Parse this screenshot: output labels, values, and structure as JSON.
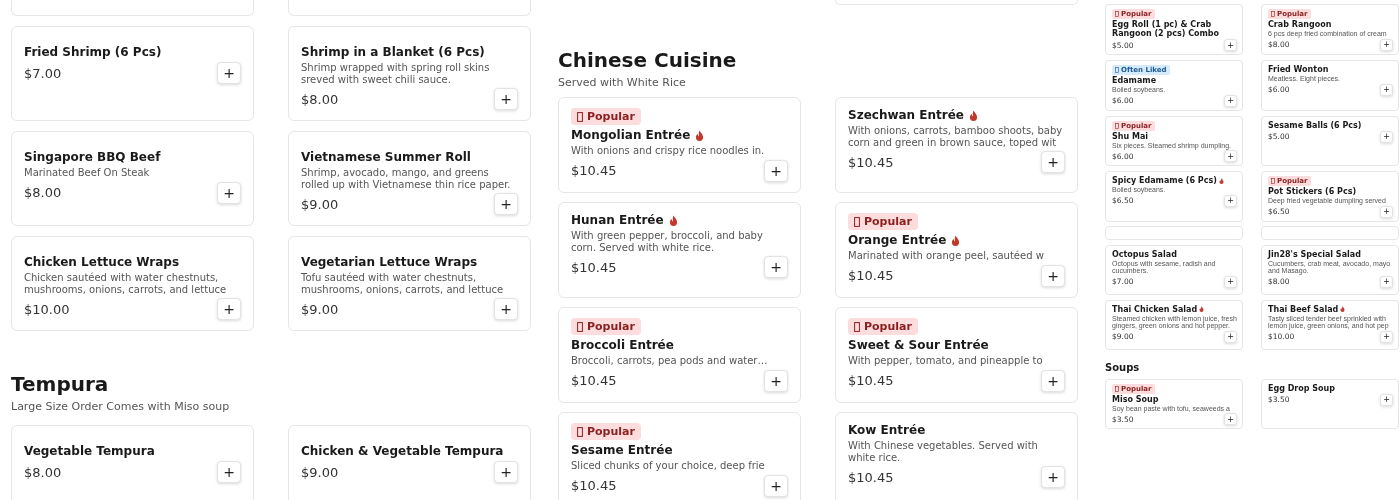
{
  "panels": [
    {
      "sections": [
        {
          "clipped_row_above": [
            {
              "shown": true
            },
            {
              "shown": true
            }
          ],
          "items": [
            {
              "name": "Fried Shrimp (6 Pcs)",
              "spicy": false,
              "price": "$7.00",
              "add_button": "+"
            },
            {
              "name": "Shrimp in a Blanket (6 Pcs)",
              "spicy": false,
              "description": "Shrimp wrapped with spring roll skins sreved with sweet chili sauce.",
              "price": "$8.00",
              "add_button": "+"
            },
            {
              "name": "Singapore BBQ Beef",
              "spicy": false,
              "description": "Marinated Beef On Steak",
              "price": "$8.00",
              "add_button": "+"
            },
            {
              "name": "Vietnamese Summer Roll",
              "spicy": false,
              "description": "Shrimp, avocado, mango, and greens rolled up with Vietnamese thin rice paper.",
              "price": "$9.00",
              "add_button": "+"
            },
            {
              "name": "Chicken Lettuce Wraps",
              "spicy": false,
              "description": "Chicken sautéed with water chestnuts, mushrooms, onions, carrots, and lettuce",
              "price": "$10.00",
              "add_button": "+"
            },
            {
              "name": "Vegetarian Lettuce Wraps",
              "spicy": false,
              "description": "Tofu sautéed with water chestnuts, mushrooms, onions, carrots, and lettuce",
              "price": "$9.00",
              "add_button": "+"
            }
          ]
        },
        {
          "title": "Tempura",
          "subtitle": "Large Size Order Comes with Miso soup",
          "items": [
            {
              "name": "Vegetable Tempura",
              "spicy": false,
              "price": "$8.00",
              "add_button": "+"
            },
            {
              "name": "Chicken & Vegetable Tempura",
              "spicy": false,
              "price": "$9.00",
              "add_button": "+"
            }
          ]
        }
      ]
    },
    {
      "sections": [
        {
          "clipped_row_above": [
            {
              "shown": false
            },
            {
              "shown": true
            }
          ],
          "title": "Chinese Cuisine",
          "subtitle": "Served with White Rice",
          "items": [
            {
              "badge": {
                "kind": "popular",
                "text": "Popular"
              },
              "name": "Mongolian Entrée",
              "spicy": true,
              "description": "With onions and crispy rice noodles in.",
              "price": "$10.45",
              "add_button": "+"
            },
            {
              "name": "Szechwan Entrée",
              "spicy": true,
              "description": "With onions, carrots, bamboo shoots, baby corn and green in brown sauce, toped wit",
              "price": "$10.45",
              "add_button": "+"
            },
            {
              "name": "Hunan Entrée",
              "spicy": true,
              "description": "With green pepper, broccoli, and baby corn. Served with white rice.",
              "price": "$10.45",
              "add_button": "+"
            },
            {
              "badge": {
                "kind": "popular",
                "text": "Popular"
              },
              "name": "Orange Entrée",
              "spicy": true,
              "description": "Marinated with orange peel, sautéed w",
              "price": "$10.45",
              "add_button": "+"
            },
            {
              "badge": {
                "kind": "popular",
                "text": "Popular"
              },
              "name": "Broccoli Entrée",
              "spicy": false,
              "description": "Broccoli, carrots, pea pods and water…",
              "price": "$10.45",
              "add_button": "+"
            },
            {
              "badge": {
                "kind": "popular",
                "text": "Popular"
              },
              "name": "Sweet & Sour Entrée",
              "spicy": false,
              "description": "With pepper, tomato, and pineapple to",
              "price": "$10.45",
              "add_button": "+"
            },
            {
              "badge": {
                "kind": "popular",
                "text": "Popular"
              },
              "name": "Sesame Entrée",
              "spicy": false,
              "description": "Sliced chunks of your choice, deep frie",
              "price": "$10.45",
              "add_button": "+"
            },
            {
              "name": "Kow Entrée",
              "spicy": false,
              "description": "With Chinese vegetables. Served with white rice.",
              "price": "$10.45",
              "add_button": "+"
            }
          ]
        }
      ]
    },
    {
      "sections": [
        {
          "items": [
            {
              "badge": {
                "kind": "popular",
                "text": "Popular"
              },
              "name": "Egg Roll (1 pc) & Crab Rangoon (2 pcs) Combo",
              "spicy": false,
              "price": "$5.00",
              "add_button": "+"
            },
            {
              "badge": {
                "kind": "popular",
                "text": "Popular"
              },
              "name": "Crab Rangoon",
              "spicy": false,
              "description": "6 pcs deep fried combination of cream",
              "price": "$8.00",
              "add_button": "+"
            },
            {
              "badge": {
                "kind": "often_liked",
                "text": "Often Liked"
              },
              "name": "Edamame",
              "spicy": false,
              "description": "Boiled soybeans.",
              "price": "$6.00",
              "add_button": "+"
            },
            {
              "name": "Fried Wonton",
              "spicy": false,
              "description": "Meatless. Eight pieces.",
              "price": "$6.00",
              "add_button": "+"
            },
            {
              "badge": {
                "kind": "popular",
                "text": "Popular"
              },
              "name": "Shu Mai",
              "spicy": false,
              "description": "Six pieces. Steamed shrimp dumpling.",
              "price": "$6.00",
              "add_button": "+"
            },
            {
              "name": "Sesame Balls (6 Pcs)",
              "spicy": false,
              "price": "$5.00",
              "add_button": "+"
            },
            {
              "name": "Spicy Edamame (6 Pcs)",
              "spicy": true,
              "description": "Boiled soybeans.",
              "price": "$6.50",
              "add_button": "+"
            },
            {
              "badge": {
                "kind": "popular",
                "text": "Popular"
              },
              "name": "Pot Stickers (6 Pcs)",
              "spicy": false,
              "description": "Deep fried vegetable dumpling served",
              "price": "$6.50",
              "add_button": "+"
            }
          ]
        },
        {
          "clipped_row_above": [
            {
              "shown": true
            },
            {
              "shown": true
            }
          ],
          "items": [
            {
              "name": "Octopus Salad",
              "spicy": false,
              "description": "Octopus with sesame, radish and cucumbers.",
              "price": "$7.00",
              "add_button": "+"
            },
            {
              "name": "Jin28's Special Salad",
              "spicy": false,
              "description": "Cucumbers, crab meat, avocado, mayo and Masago.",
              "price": "$8.00",
              "add_button": "+"
            },
            {
              "name": "Thai Chicken Salad",
              "spicy": true,
              "description": "Steamed chicken with lemon juice, fresh gingers, green onions and hot pepper.",
              "price": "$9.00",
              "add_button": "+"
            },
            {
              "name": "Thai Beef Salad",
              "spicy": true,
              "description": "Tasty sliced tender beef sprinkled with lemon juice, green onions, and hot pep",
              "price": "$10.00",
              "add_button": "+"
            }
          ]
        },
        {
          "title": "Soups",
          "items": [
            {
              "badge": {
                "kind": "popular",
                "text": "Popular"
              },
              "name": "Miso Soup",
              "spicy": false,
              "description": "Soy bean paste with tofu, seaweeds a",
              "price": "$3.50",
              "add_button": "+"
            },
            {
              "name": "Egg Drop Soup",
              "spicy": false,
              "price": "$3.50",
              "add_button": "+"
            }
          ]
        }
      ]
    }
  ]
}
